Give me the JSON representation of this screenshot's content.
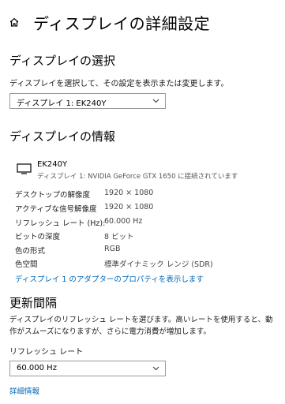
{
  "header": {
    "home_icon": "home-icon",
    "title": "ディスプレイの詳細設定"
  },
  "select_display": {
    "heading": "ディスプレイの選択",
    "description": "ディスプレイを選択して、その設定を表示または変更します。",
    "dropdown_value": "ディスプレイ 1: EK240Y",
    "dropdown_icon": "chevron-down-icon"
  },
  "display_info": {
    "heading": "ディスプレイの情報",
    "monitor_icon": "monitor-icon",
    "monitor_name": "EK240Y",
    "monitor_subtitle": "ディスプレイ 1: NVIDIA GeForce GTX 1650 に接続されています",
    "rows": [
      {
        "label": "デスクトップの解像度",
        "value": "1920 × 1080"
      },
      {
        "label": "アクティブな信号解像度",
        "value": "1920 × 1080"
      },
      {
        "label": "リフレッシュ レート (Hz):",
        "value": "60.000 Hz"
      },
      {
        "label": "ビットの深度",
        "value": "8 ビット"
      },
      {
        "label": "色の形式",
        "value": "RGB"
      },
      {
        "label": "色空間",
        "value": "標準ダイナミック レンジ (SDR)"
      }
    ],
    "adapter_link": "ディスプレイ 1 のアダプターのプロパティを表示します"
  },
  "refresh": {
    "heading": "更新間隔",
    "description": "ディスプレイのリフレッシュ レートを選びます。高いレートを使用すると、動作がスムーズになりますが、さらに電力消費が増加します。",
    "label": "リフレッシュ レート",
    "dropdown_value": "60.000 Hz",
    "dropdown_icon": "chevron-down-icon",
    "details_link": "詳細情報"
  },
  "colors": {
    "link": "#0067b8",
    "border": "#999999"
  }
}
